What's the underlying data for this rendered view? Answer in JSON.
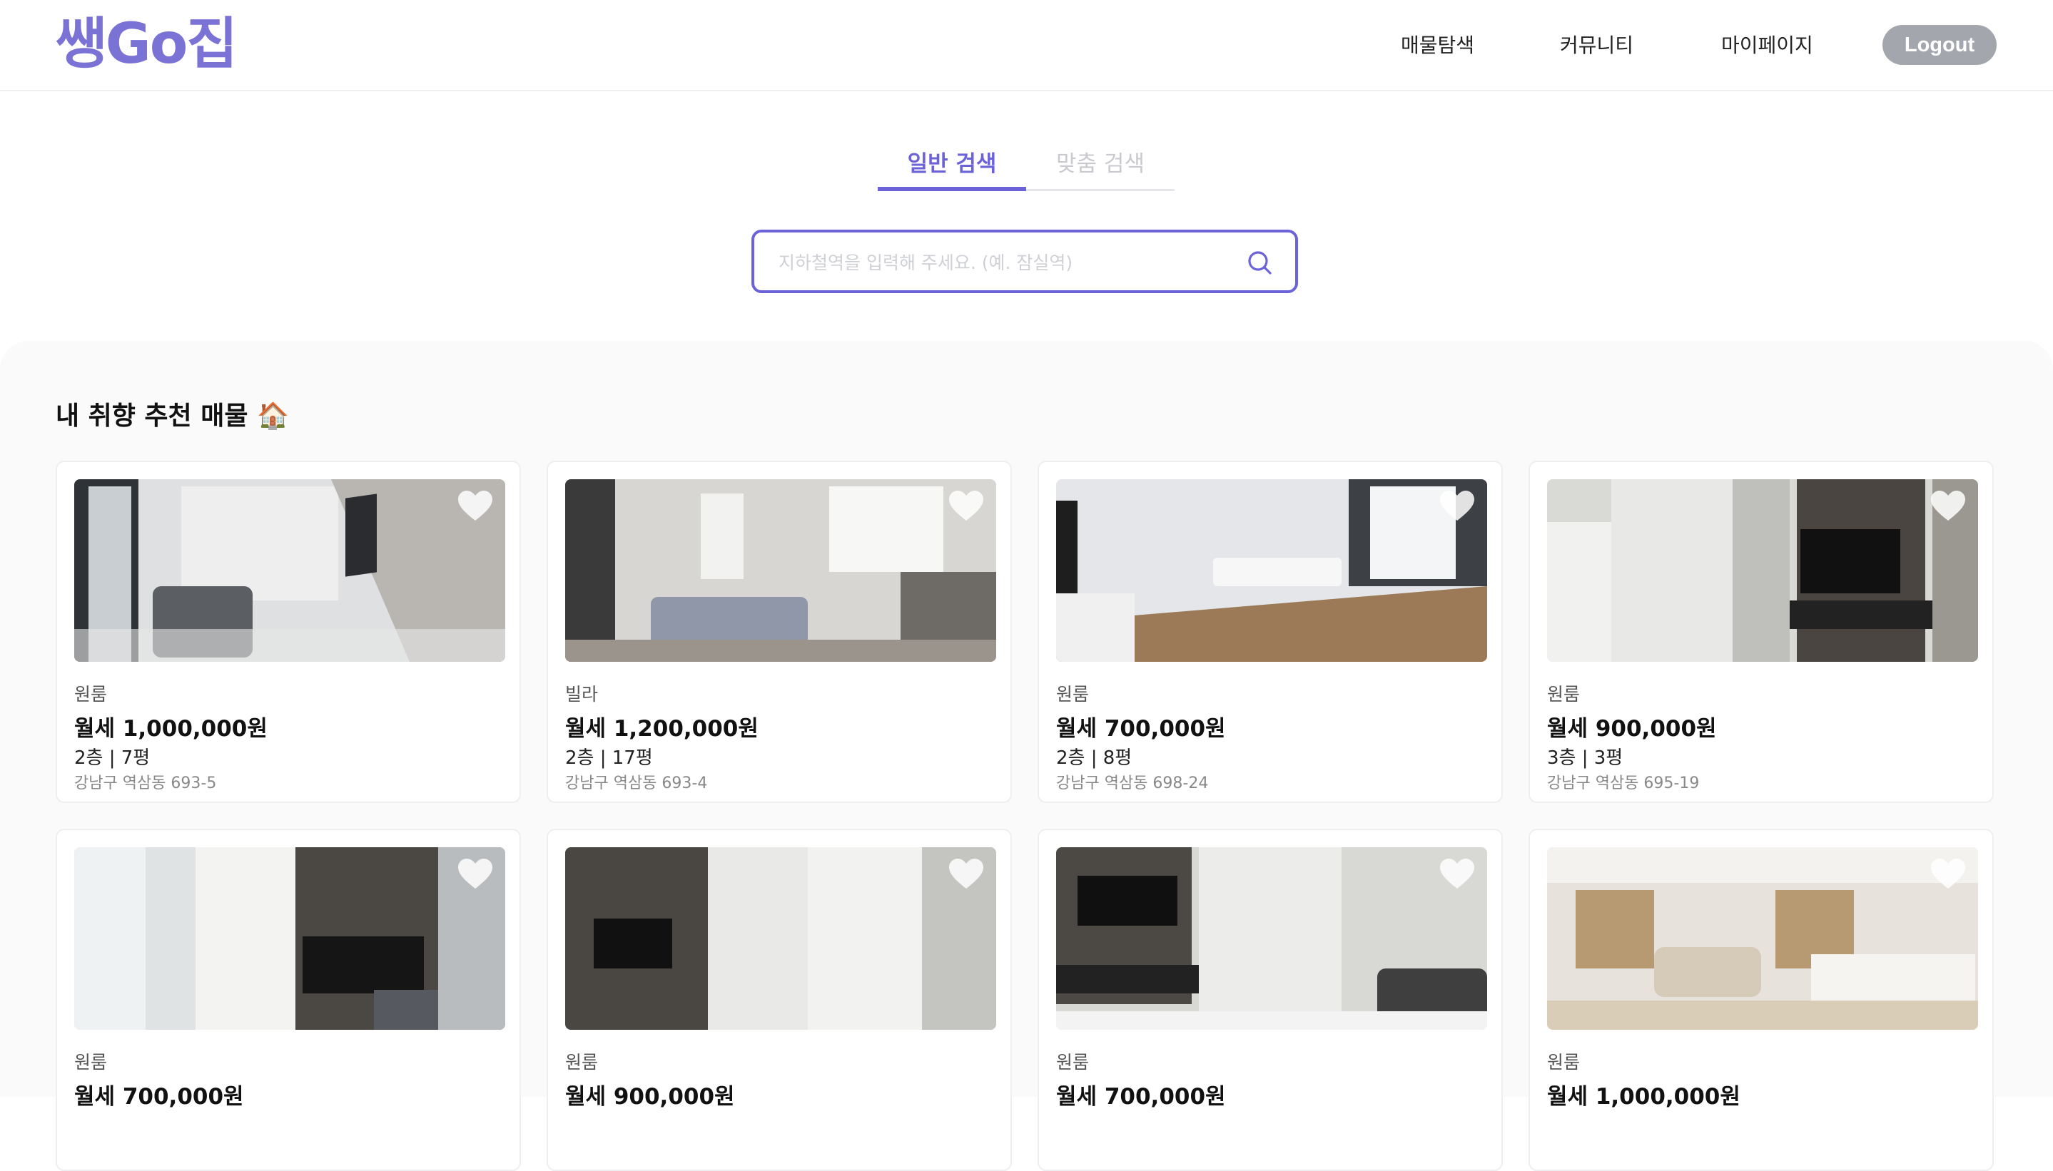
{
  "app": {
    "logo": "쌩Go집"
  },
  "nav": {
    "items": [
      "매물탐색",
      "커뮤니티",
      "마이페이지"
    ],
    "logout": "Logout"
  },
  "search": {
    "tabs": [
      "일반 검색",
      "맞춤 검색"
    ],
    "active_tab": "일반 검색",
    "placeholder": "지하철역을 입력해 주세요. (예. 잠실역)",
    "value": ""
  },
  "recommend": {
    "title": "내 취향 추천 매물 🏠",
    "cards": [
      {
        "type": "원룸",
        "price": "월세 1,000,000원",
        "floor": "2층 | 7평",
        "address": "강남구 역삼동 693-5"
      },
      {
        "type": "빌라",
        "price": "월세 1,200,000원",
        "floor": "2층 | 17평",
        "address": "강남구 역삼동 693-4"
      },
      {
        "type": "원룸",
        "price": "월세 700,000원",
        "floor": "2층 | 8평",
        "address": "강남구 역삼동 698-24"
      },
      {
        "type": "원룸",
        "price": "월세 900,000원",
        "floor": "3층 | 3평",
        "address": "강남구 역삼동 695-19"
      },
      {
        "type": "원룸",
        "price": "월세 700,000원",
        "floor": "",
        "address": ""
      },
      {
        "type": "원룸",
        "price": "월세 900,000원",
        "floor": "",
        "address": ""
      },
      {
        "type": "원룸",
        "price": "월세 700,000원",
        "floor": "",
        "address": ""
      },
      {
        "type": "원룸",
        "price": "월세 1,000,000원",
        "floor": "",
        "address": ""
      }
    ]
  },
  "colors": {
    "accent": "#6c63d9",
    "logo": "#7b72d6",
    "logout_bg": "#a3a6ad"
  },
  "icons": {
    "search": "search-icon",
    "favorite": "heart-icon"
  }
}
